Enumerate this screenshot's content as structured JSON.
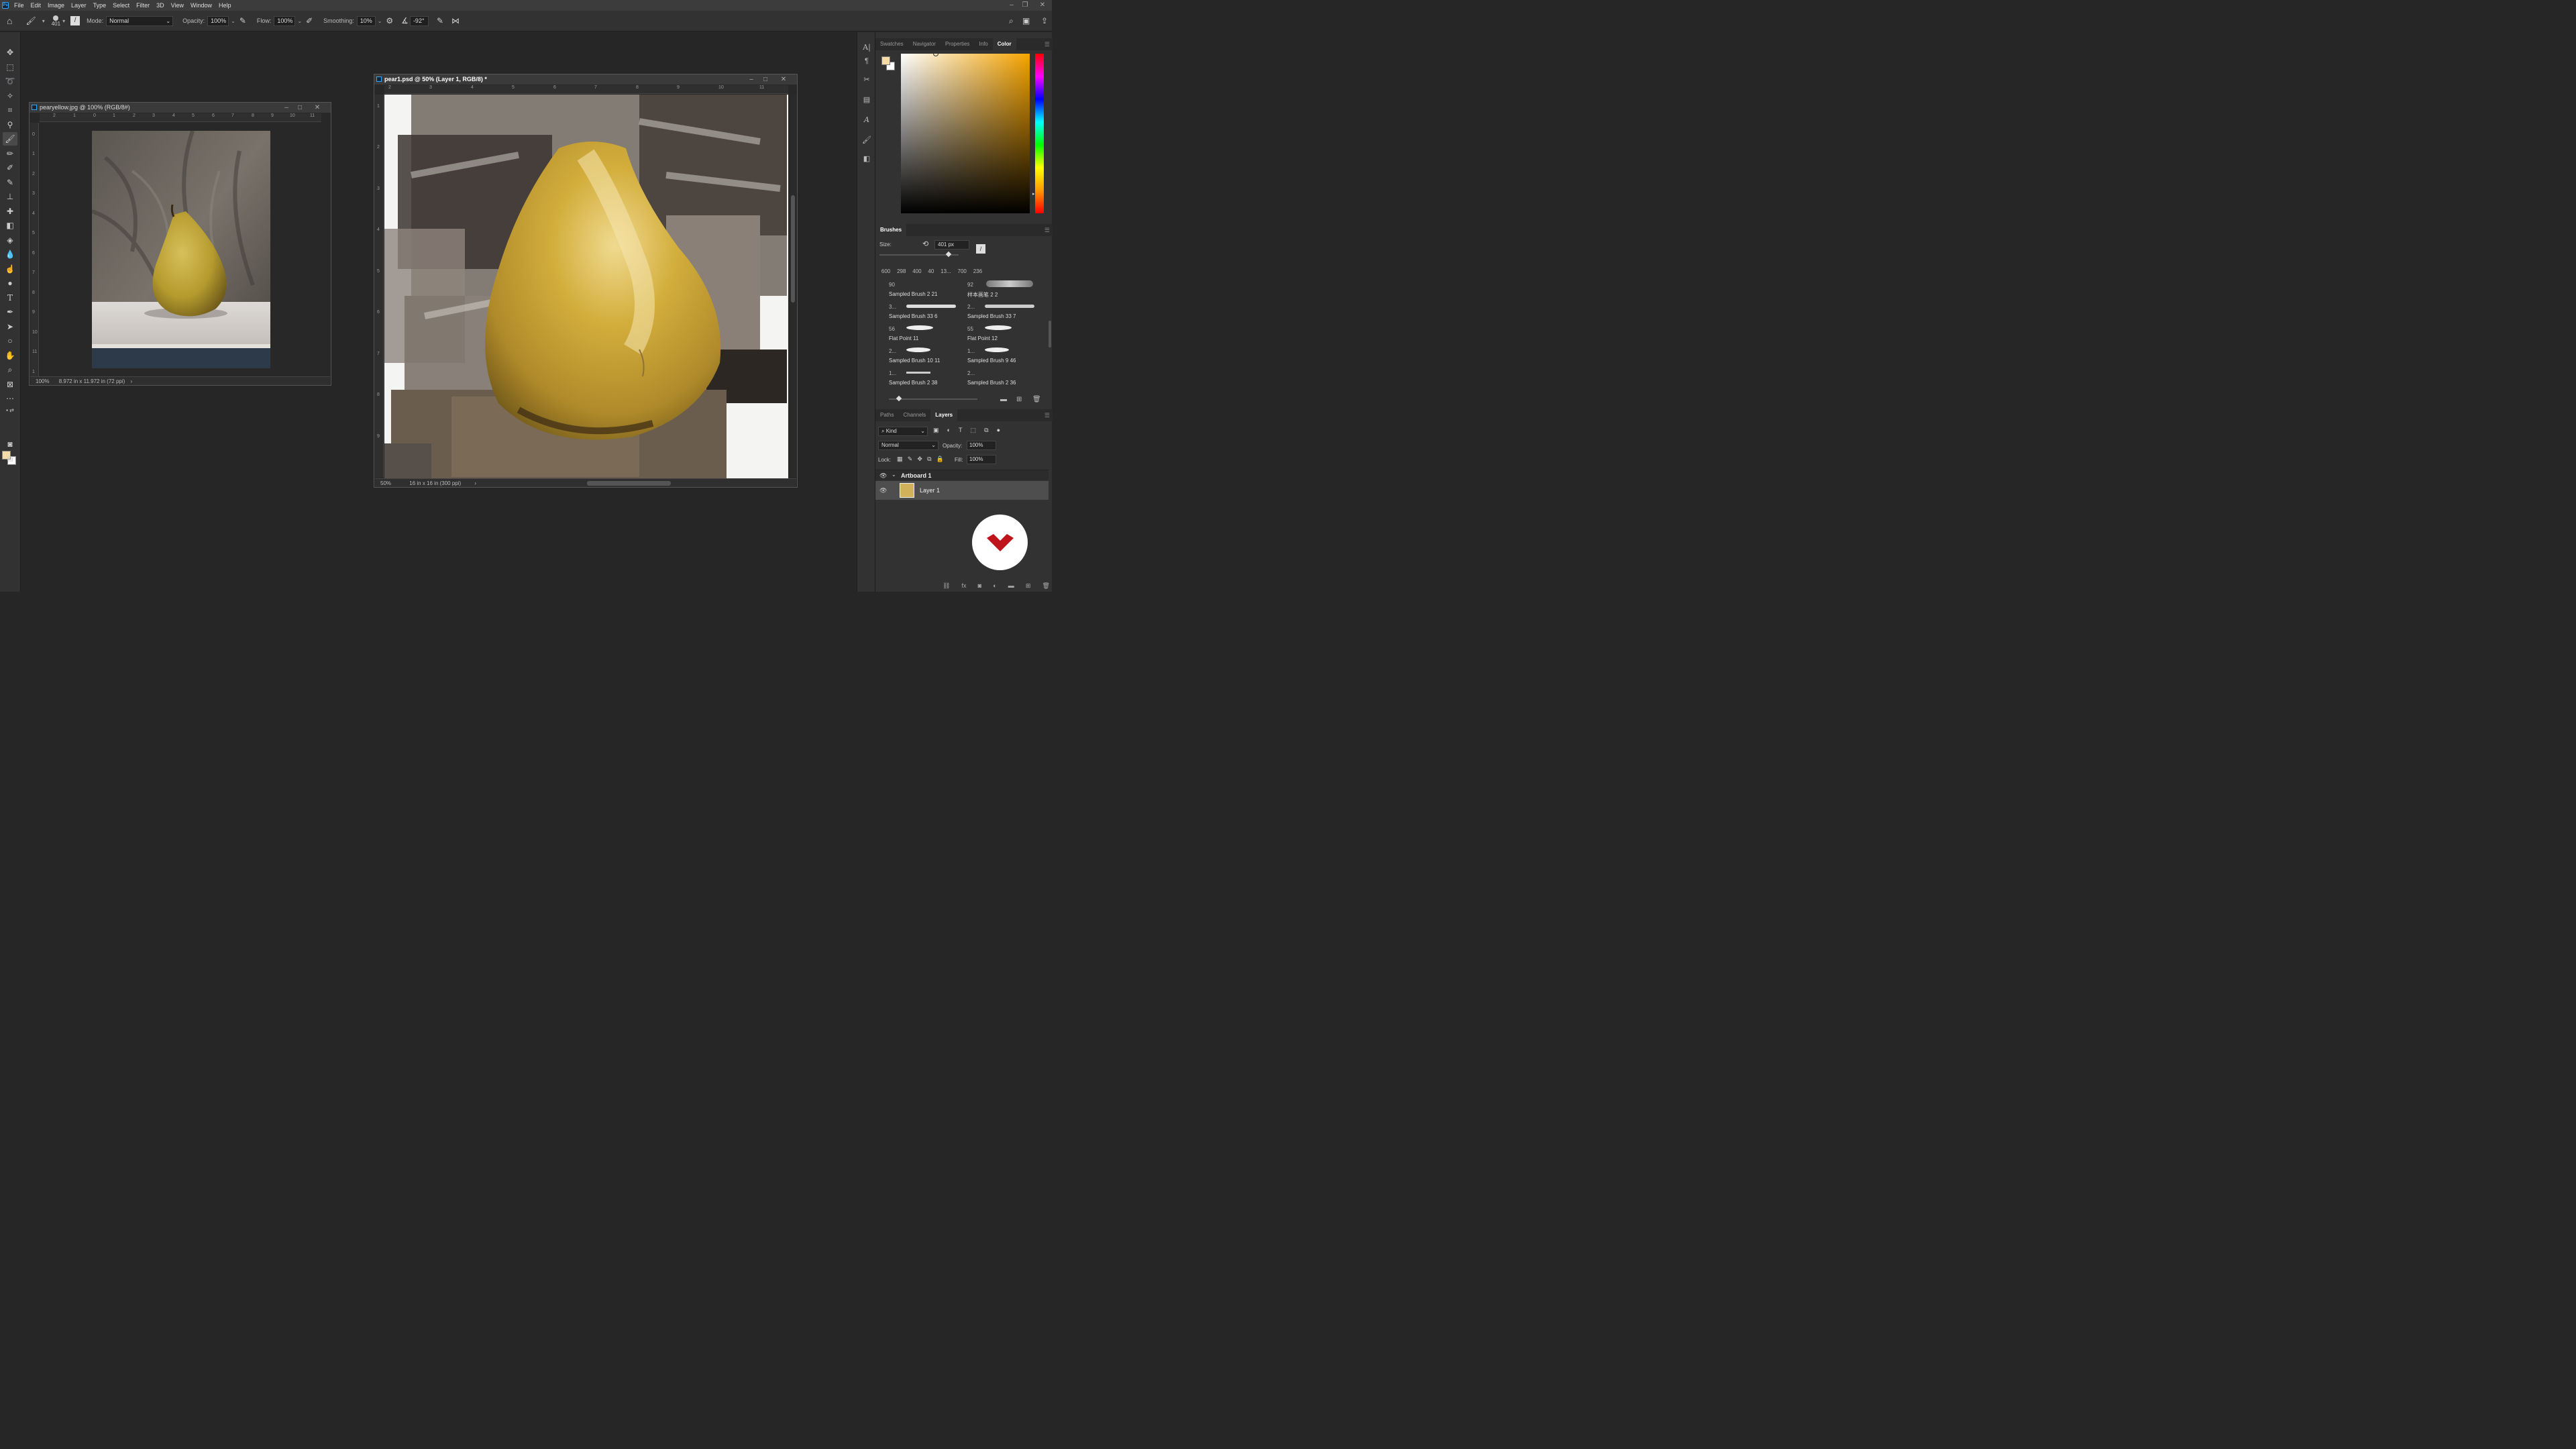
{
  "app": {
    "icon_label": "Ps"
  },
  "menu": [
    "File",
    "Edit",
    "Image",
    "Layer",
    "Type",
    "Select",
    "Filter",
    "3D",
    "View",
    "Window",
    "Help"
  ],
  "window_controls": {
    "minimize": "–",
    "restore": "❐",
    "close": "✕"
  },
  "options_bar": {
    "brush_size": "401",
    "mode_label": "Mode:",
    "mode_value": "Normal",
    "opacity_label": "Opacity:",
    "opacity_value": "100%",
    "flow_label": "Flow:",
    "flow_value": "100%",
    "smoothing_label": "Smoothing:",
    "smoothing_value": "10%",
    "angle_value": "-92°"
  },
  "doc_reference": {
    "title": "pearyellow.jpg @ 100% (RGB/8#)",
    "ruler_h": [
      "2",
      "1",
      "0",
      "1",
      "2",
      "3",
      "4",
      "5",
      "6",
      "7",
      "8",
      "9",
      "10",
      "11"
    ],
    "ruler_v": [
      "0",
      "1",
      "2",
      "3",
      "4",
      "5",
      "6",
      "7",
      "8",
      "9",
      "10",
      "11",
      "1"
    ],
    "zoom": "100%",
    "dims": "8.972 in x 11.972 in (72 ppi)"
  },
  "doc_main": {
    "title": "pear1.psd @ 50% (Layer 1, RGB/8) *",
    "ruler_h": [
      "2",
      "3",
      "4",
      "5",
      "6",
      "7",
      "8",
      "9",
      "10",
      "11"
    ],
    "ruler_v": [
      "1",
      "2",
      "3",
      "4",
      "5",
      "6",
      "7",
      "8",
      "9"
    ],
    "zoom": "50%",
    "dims": "16 in x 16 in (300 ppi)"
  },
  "color_panel": {
    "tabs": [
      "Swatches",
      "Navigator",
      "Properties",
      "Info",
      "Color"
    ],
    "active_tab": "Color",
    "hue": "#f5a300",
    "foreground": "#f4dba8",
    "background": "#ffffff"
  },
  "brushes_panel": {
    "title": "Brushes",
    "size_label": "Size:",
    "size_value": "401 px",
    "presets": [
      "600",
      "298",
      "400",
      "40",
      "13...",
      "700",
      "236"
    ],
    "brushes": [
      {
        "num": "90",
        "name": "Sampled Brush 2 21"
      },
      {
        "num": "92",
        "name": "样本画笔 2 2"
      },
      {
        "num": "3...",
        "name": "Sampled Brush 33 6"
      },
      {
        "num": "2...",
        "name": "Sampled Brush 33 7"
      },
      {
        "num": "56",
        "name": "Flat Point 11"
      },
      {
        "num": "55",
        "name": "Flat Point 12"
      },
      {
        "num": "2...",
        "name": "Sampled Brush 10 11"
      },
      {
        "num": "1...",
        "name": "Sampled Brush 9 46"
      },
      {
        "num": "1...",
        "name": "Sampled Brush 2 38"
      },
      {
        "num": "2...",
        "name": "Sampled Brush 2 36"
      }
    ]
  },
  "layers_panel": {
    "tabs": [
      "Paths",
      "Channels",
      "Layers"
    ],
    "active_tab": "Layers",
    "kind_label": "Kind",
    "blend_mode": "Normal",
    "opacity_label": "Opacity:",
    "opacity_value": "100%",
    "lock_label": "Lock:",
    "fill_label": "Fill:",
    "fill_value": "100%",
    "artboard_name": "Artboard 1",
    "layer_name": "Layer 1"
  }
}
